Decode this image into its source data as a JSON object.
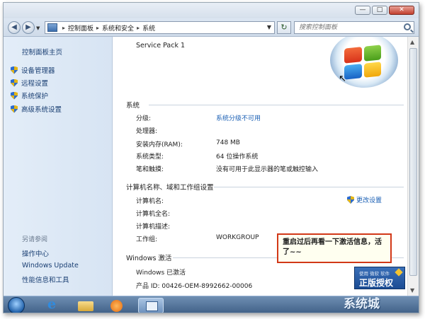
{
  "window": {
    "controls": {
      "minimize": "—",
      "maximize": "□",
      "close": "✕"
    }
  },
  "address": {
    "crumbs": [
      "控制面板",
      "系统和安全",
      "系统"
    ],
    "search_placeholder": "搜索控制面板",
    "back": "◀",
    "forward": "▶",
    "refresh": "↻"
  },
  "left_pane": {
    "home": "控制面板主页",
    "tasks": [
      "设备管理器",
      "远程设置",
      "系统保护",
      "高级系统设置"
    ],
    "see_also_title": "另请参阅",
    "see_also": [
      "操作中心",
      "Windows Update",
      "性能信息和工具"
    ]
  },
  "main": {
    "service_pack": "Service Pack 1",
    "system_section": {
      "title": "系统",
      "rows": [
        {
          "label": "分级:",
          "value": "系统分级不可用",
          "is_link": true
        },
        {
          "label": "处理器:",
          "value": "",
          "is_link": false
        },
        {
          "label": "安装内存(RAM):",
          "value": "748 MB",
          "is_link": false
        },
        {
          "label": "系统类型:",
          "value": "64 位操作系统",
          "is_link": false
        },
        {
          "label": "笔和触摸:",
          "value": "没有可用于此显示器的笔或触控输入",
          "is_link": false
        }
      ]
    },
    "computer_section": {
      "title": "计算机名称、域和工作组设置",
      "change_settings": "更改设置",
      "rows": [
        {
          "label": "计算机名:",
          "value": ""
        },
        {
          "label": "计算机全名:",
          "value": ""
        },
        {
          "label": "计算机描述:",
          "value": ""
        },
        {
          "label": "工作组:",
          "value": "WORKGROUP"
        }
      ]
    },
    "activation_section": {
      "title": "Windows 激活",
      "status": "Windows 已激活",
      "product_id": "产品 ID: 00426-OEM-8992662-00006"
    },
    "callout": "重启过后再看一下激活信息，活了~~",
    "genuine_badge": {
      "top": "使用 微软 软件",
      "main": "正版授权"
    }
  },
  "taskbar": {
    "items": [
      "start-orb",
      "internet-explorer",
      "windows-explorer",
      "media-player",
      "control-panel"
    ]
  },
  "watermark": "系统城"
}
